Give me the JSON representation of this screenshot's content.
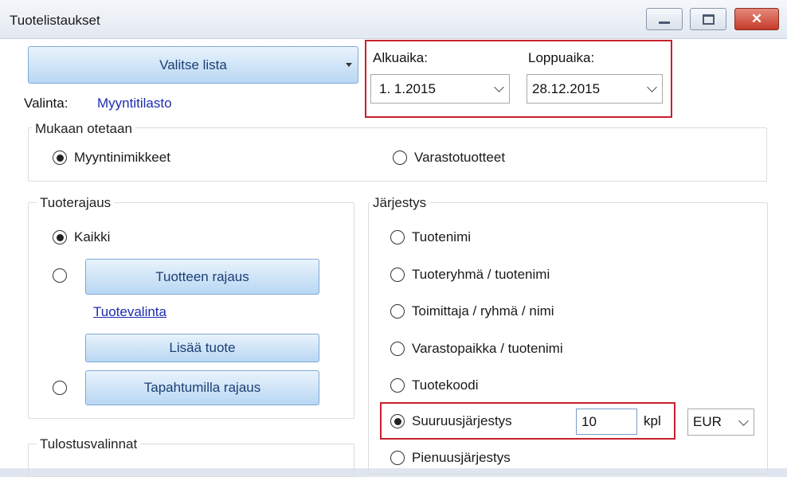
{
  "window": {
    "title": "Tuotelistaukset",
    "buttons": {
      "minimize": "minimize-icon",
      "maximize": "maximize-icon",
      "close": "close-icon"
    }
  },
  "top": {
    "select_list_button": "Valitse lista",
    "selection_label": "Valinta:",
    "selection_value": "Myyntitilasto",
    "start_label": "Alkuaika:",
    "start_value": "1.  1.2015",
    "end_label": "Loppuaika:",
    "end_value": "28.12.2015"
  },
  "include": {
    "legend": "Mukaan otetaan",
    "options": [
      "Myyntinimikkeet",
      "Varastotuotteet"
    ],
    "selected": 0
  },
  "product_filter": {
    "legend": "Tuoterajaus",
    "all_label": "Kaikki",
    "product_filter_button": "Tuotteen rajaus",
    "product_selection_link": "Tuotevalinta",
    "add_product_button": "Lisää tuote",
    "event_filter_button": "Tapahtumilla rajaus"
  },
  "order": {
    "legend": "Järjestys",
    "options": [
      "Tuotenimi",
      "Tuoteryhmä / tuotenimi",
      "Toimittaja / ryhmä / nimi",
      "Varastopaikka / tuotenimi",
      "Tuotekoodi",
      "Suuruusjärjestys",
      "Pienuusjärjestys"
    ],
    "selected": 5,
    "count_value": "10",
    "count_unit": "kpl",
    "currency": "EUR"
  },
  "print_options": {
    "legend": "Tulostusvalinnat"
  },
  "colors": {
    "highlight_red": "#c8202d",
    "button_blue": "#b9d7f3",
    "link": "#1d2db0"
  }
}
